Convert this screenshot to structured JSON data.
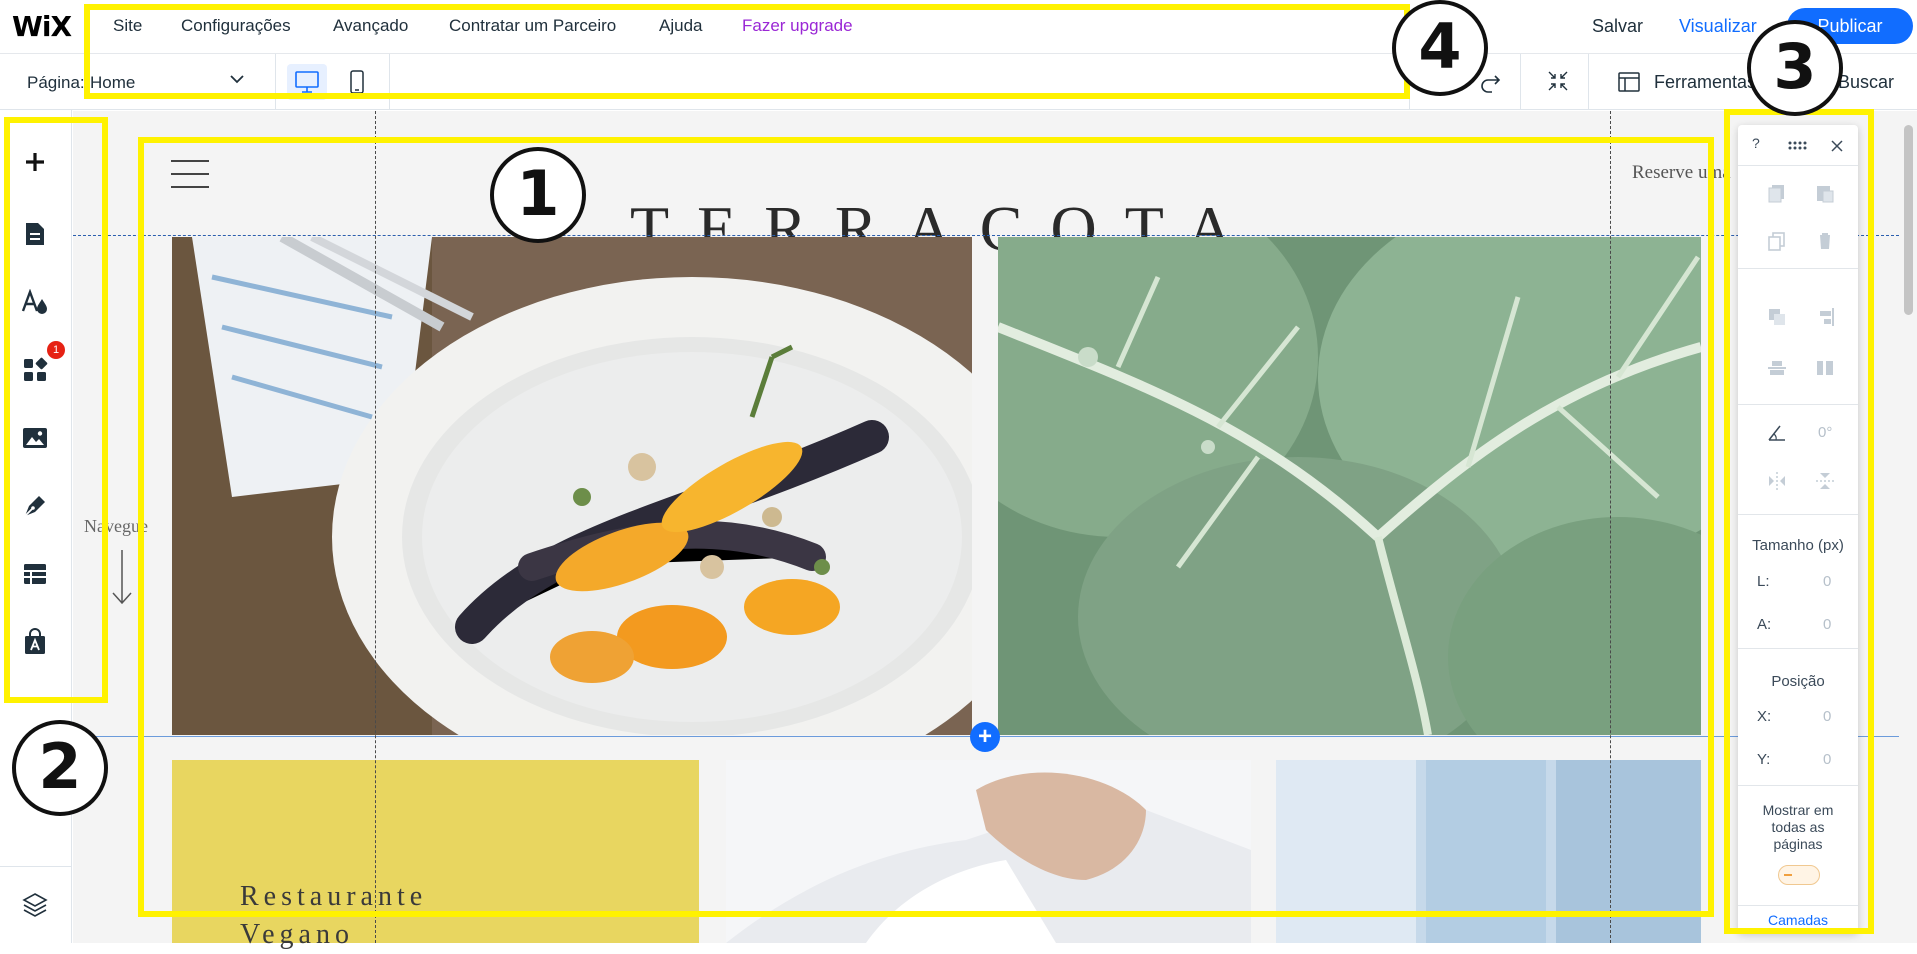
{
  "topbar": {
    "logo": "WiX",
    "menu": [
      "Site",
      "Configurações",
      "Avançado",
      "Contratar um Parceiro",
      "Ajuda",
      "Fazer upgrade"
    ],
    "save": "Salvar",
    "preview": "Visualizar",
    "publish": "Publicar"
  },
  "secondbar": {
    "page_label": "Página:",
    "page_value": "Home",
    "tools": "Ferramentas",
    "search": "Buscar"
  },
  "leftrail": {
    "icons": [
      "add-icon",
      "pages-icon",
      "design-icon",
      "apps-icon",
      "media-icon",
      "blog-icon",
      "table-icon",
      "store-icon",
      "layers-icon"
    ],
    "badge": "1"
  },
  "canvas": {
    "title": "TERRACOTA",
    "reserve": "Reserve uma",
    "navegue": "Navegue",
    "yellow_text_1": "Restaurante",
    "yellow_text_2": "Vegano",
    "add_section": "+"
  },
  "toolbar": {
    "help": "?",
    "rotation": "0°",
    "size_label": "Tamanho (px)",
    "width_label": "L:",
    "width_value": "0",
    "height_label": "A:",
    "height_value": "0",
    "position_label": "Posição",
    "x_label": "X:",
    "x_value": "0",
    "y_label": "Y:",
    "y_value": "0",
    "show_all_pages": "Mostrar em todas as páginas",
    "layers": "Camadas"
  },
  "annotations": [
    "1",
    "2",
    "3",
    "4"
  ],
  "colors": {
    "annotation": "#fff200",
    "accent": "#116dff",
    "upgrade": "#9a27d5",
    "badge": "#e62214"
  }
}
